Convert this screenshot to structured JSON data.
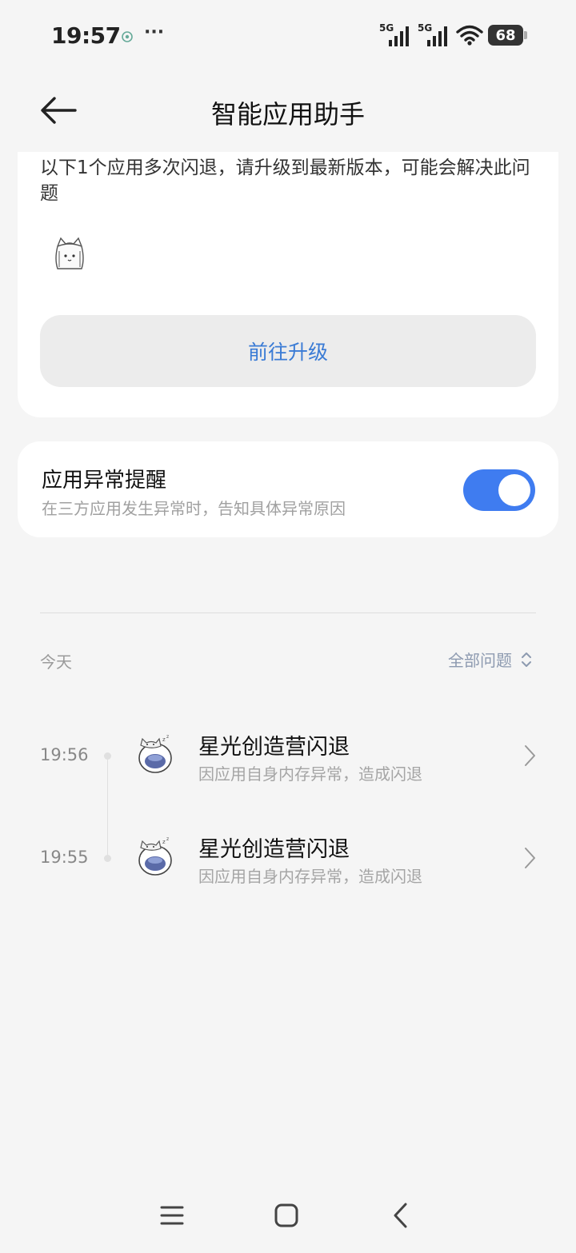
{
  "status_bar": {
    "time": "19:57",
    "more": "···",
    "signal1_label": "5G",
    "signal2_label": "5G",
    "battery": "68"
  },
  "header": {
    "title": "智能应用助手"
  },
  "crash_card": {
    "description": "以下1个应用多次闪退，请升级到最新版本，可能会解决此问题",
    "upgrade_button": "前往升级"
  },
  "alert_setting": {
    "title": "应用异常提醒",
    "subtitle": "在三方应用发生异常时，告知具体异常原因",
    "enabled": true
  },
  "history": {
    "date_label": "今天",
    "filter_label": "全部问题",
    "events": [
      {
        "time": "19:56",
        "title": "星光创造营闪退",
        "subtitle": "因应用自身内存异常，造成闪退"
      },
      {
        "time": "19:55",
        "title": "星光创造营闪退",
        "subtitle": "因应用自身内存异常，造成闪退"
      }
    ]
  },
  "colors": {
    "accent": "#3f7cf0",
    "link": "#3a7bd5",
    "background": "#f5f5f5"
  },
  "icons": {
    "back": "arrow-left-icon",
    "chevron_updown": "chevron-updown-icon",
    "row_arrow": "chevron-right-icon",
    "nav_menu": "menu-icon",
    "nav_home": "square-home-icon",
    "nav_back": "chevron-left-icon"
  }
}
